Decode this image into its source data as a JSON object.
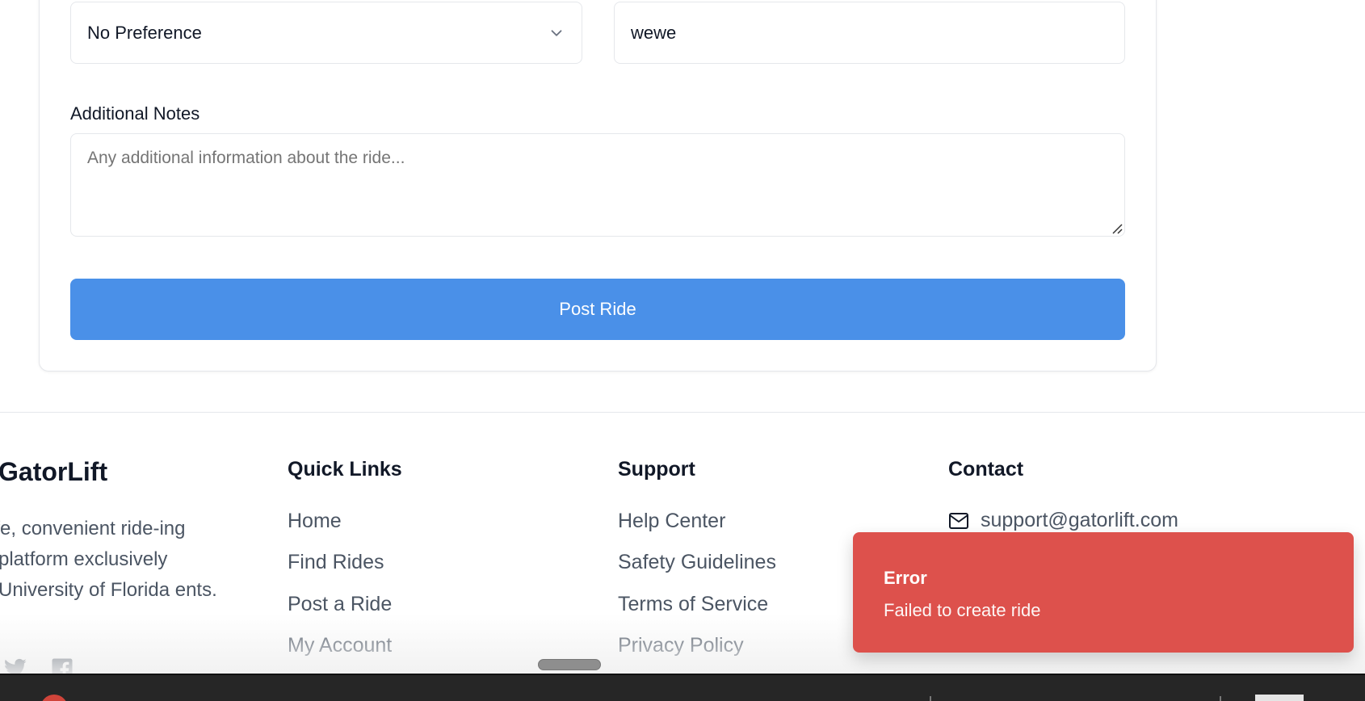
{
  "form": {
    "preference_value": "No Preference",
    "text_value": "wewe",
    "notes_label": "Additional Notes",
    "notes_placeholder": "Any additional information about the ride...",
    "submit_label": "Post Ride"
  },
  "footer": {
    "brand": "GatorLift",
    "tagline": "safe, convenient ride-ing platform exclusively University of Florida ents.",
    "quick_links": {
      "title": "Quick Links",
      "items": [
        "Home",
        "Find Rides",
        "Post a Ride",
        "My Account"
      ]
    },
    "support": {
      "title": "Support",
      "items": [
        "Help Center",
        "Safety Guidelines",
        "Terms of Service",
        "Privacy Policy"
      ]
    },
    "contact": {
      "title": "Contact",
      "email": "support@gatorlift.com"
    },
    "social_icons": [
      "twitter-icon",
      "facebook-icon"
    ]
  },
  "toast": {
    "title": "Error",
    "message": "Failed to create ride"
  },
  "colors": {
    "primary": "#4a90e8",
    "error": "#dd514c",
    "border": "#e5e7eb",
    "muted_text": "#4b5563"
  }
}
